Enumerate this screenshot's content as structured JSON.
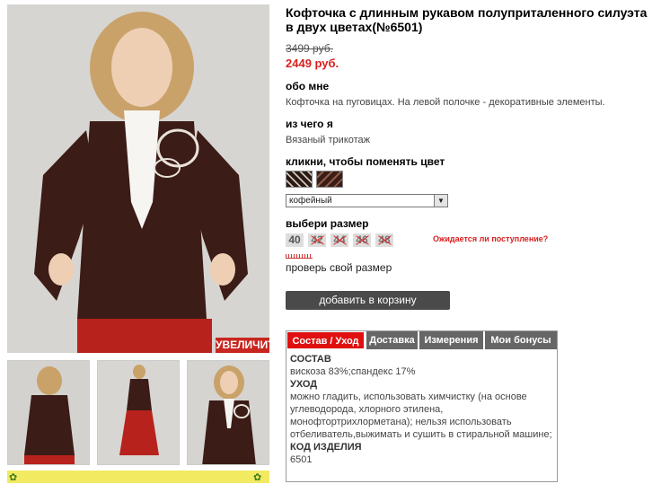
{
  "product": {
    "title": "Кофточка с длинным рукавом полуприталенного силуэта в двух цветах(№6501)",
    "old_price": "3499 руб.",
    "new_price": "2449 руб.",
    "about_heading": "обо мне",
    "about_text": "Кофточка на пуговицах. На левой полочке - декоративные элементы.",
    "material_heading": "из чего я",
    "material_text": "Вязаный трикотаж",
    "color_heading": "кликни, чтобы поменять цвет",
    "color_selected": "кофейный",
    "size_heading": "выбери размер",
    "sizes": [
      {
        "label": "40",
        "available": true
      },
      {
        "label": "42",
        "available": false
      },
      {
        "label": "44",
        "available": false
      },
      {
        "label": "46",
        "available": false
      },
      {
        "label": "48",
        "available": false
      }
    ],
    "expected_link": "Ожидается ли поступление?",
    "check_size_link": "проверь свой размер",
    "add_to_cart": "добавить в корзину"
  },
  "gallery": {
    "zoom_label": "УВЕЛИЧИТЬ"
  },
  "tabs": {
    "labels": [
      "Состав / Уход",
      "Доставка",
      "Измерения",
      "Мои бонусы"
    ],
    "active": 0,
    "content": {
      "composition_heading": "СОСТАВ",
      "composition_text": "вискоза 83%;спандекс 17%",
      "care_heading": "УХОД",
      "care_text": "можно гладить, использовать химчистку (на основе углеводорода, хлорного этилена, монофтортрихлорметана); нельзя использовать отбеливатель,выжимать и сушить в стиральной машине;",
      "code_heading": "КОД ИЗДЕЛИЯ",
      "code_text": "6501"
    }
  },
  "colors": {
    "accent_red": "#d82020",
    "cart_button": "#4a4a4a",
    "tab_inactive": "#666666",
    "garment_brown": "#3b1c16",
    "skirt_red": "#b8221c"
  }
}
